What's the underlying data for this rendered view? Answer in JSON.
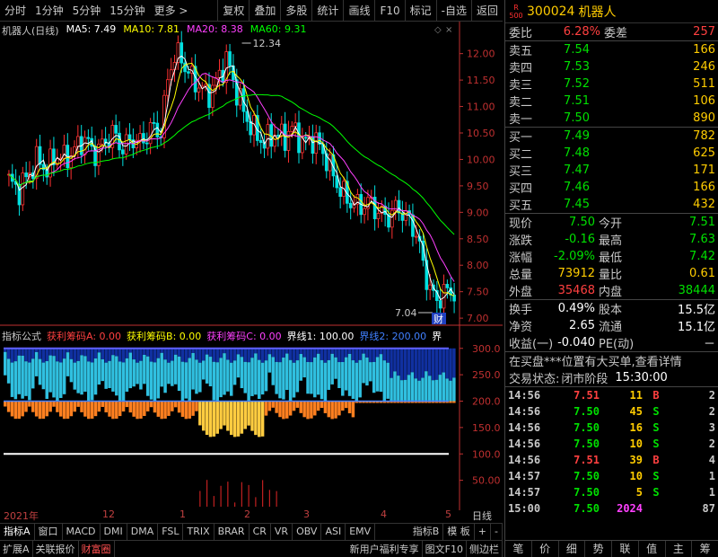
{
  "toolbar": {
    "left": [
      "分时",
      "1分钟",
      "5分钟",
      "15分钟",
      "更多 >"
    ],
    "right": [
      "复权",
      "叠加",
      "多股",
      "统计",
      "画线",
      "F10",
      "标记",
      "-自选",
      "返回"
    ]
  },
  "main_header": {
    "title": "机器人(日线)",
    "ma5": "MA5: 7.49",
    "ma10": "MA10: 7.81",
    "ma20": "MA20: 8.38",
    "ma60": "MA60: 9.31"
  },
  "indicator_header": {
    "name": "指标公式",
    "a": "获利筹码A: 0.00",
    "b": "获利筹码B: 0.00",
    "c": "获利筹码C: 0.00",
    "j1": "界线1: 100.00",
    "j2": "界线2: 200.00",
    "more": "界"
  },
  "annotations": {
    "high": "12.34",
    "low": "7.04",
    "cai": "财"
  },
  "price_axis": [
    "12.00",
    "11.50",
    "11.00",
    "10.50",
    "10.00",
    "9.50",
    "9.00",
    "8.50",
    "8.00",
    "7.50",
    "7.00"
  ],
  "ind_axis": [
    "300.0",
    "250.0",
    "200.0",
    "150.0",
    "100.0",
    "50.00"
  ],
  "x_axis": {
    "start": "2021年",
    "m12": "12",
    "m1": "1",
    "m2": "2",
    "m3": "3",
    "m4": "4",
    "m5": "5",
    "rlabel": "日线"
  },
  "bottom_tabs": [
    "指标A",
    "窗口",
    "MACD",
    "DMI",
    "DMA",
    "FSL",
    "TRIX",
    "BRAR",
    "CR",
    "VR",
    "OBV",
    "ASI",
    "EMV",
    "指标B",
    "模 板",
    "+",
    "-"
  ],
  "footer_tabs": [
    "扩展A",
    "关联报价",
    "财富圈"
  ],
  "footer_right": [
    "新用户福利专享",
    "图文F10",
    "侧边栏"
  ],
  "stock": {
    "badge_top": "R",
    "badge_bottom": "500",
    "code": "300024",
    "name": "机器人"
  },
  "order_book": {
    "ratio_label": "委比",
    "ratio": "6.28%",
    "diff_label": "委差",
    "diff": "257",
    "asks": [
      {
        "label": "卖五",
        "price": "7.54",
        "vol": "166"
      },
      {
        "label": "卖四",
        "price": "7.53",
        "vol": "246"
      },
      {
        "label": "卖三",
        "price": "7.52",
        "vol": "511"
      },
      {
        "label": "卖二",
        "price": "7.51",
        "vol": "106"
      },
      {
        "label": "卖一",
        "price": "7.50",
        "vol": "890"
      }
    ],
    "bids": [
      {
        "label": "买一",
        "price": "7.49",
        "vol": "782"
      },
      {
        "label": "买二",
        "price": "7.48",
        "vol": "625"
      },
      {
        "label": "买三",
        "price": "7.47",
        "vol": "171"
      },
      {
        "label": "买四",
        "price": "7.46",
        "vol": "166"
      },
      {
        "label": "买五",
        "price": "7.45",
        "vol": "432"
      }
    ]
  },
  "quote": [
    {
      "l1": "现价",
      "v1": "7.50",
      "c1": "#00e000",
      "l2": "今开",
      "v2": "7.51",
      "c2": "#00e000"
    },
    {
      "l1": "涨跌",
      "v1": "-0.16",
      "c1": "#00e000",
      "l2": "最高",
      "v2": "7.63",
      "c2": "#00e000"
    },
    {
      "l1": "涨幅",
      "v1": "-2.09%",
      "c1": "#00e000",
      "l2": "最低",
      "v2": "7.42",
      "c2": "#00e000"
    },
    {
      "l1": "总量",
      "v1": "73912",
      "c1": "#ffcc00",
      "l2": "量比",
      "v2": "0.61",
      "c2": "#ffcc00"
    },
    {
      "l1": "外盘",
      "v1": "35468",
      "c1": "#ff4040",
      "l2": "内盘",
      "v2": "38444",
      "c2": "#00e000"
    }
  ],
  "quote2": [
    {
      "l1": "换手",
      "v1": "0.49%",
      "l2": "股本",
      "v2": "15.5亿"
    },
    {
      "l1": "净资",
      "v1": "2.65",
      "l2": "流通",
      "v2": "15.1亿"
    },
    {
      "l1": "收益(一)",
      "v1": "-0.040",
      "l2": "PE(动)",
      "v2": "－"
    }
  ],
  "notice": "在买盘***位置有大买单,查看详情",
  "status": {
    "label": "交易状态:",
    "value": "闭市阶段",
    "time": "15:30:00"
  },
  "ticks": [
    {
      "t": "14:56",
      "p": "7.51",
      "v": "11",
      "bs": "B",
      "n": "2"
    },
    {
      "t": "14:56",
      "p": "7.50",
      "v": "45",
      "bs": "S",
      "n": "2"
    },
    {
      "t": "14:56",
      "p": "7.50",
      "v": "16",
      "bs": "S",
      "n": "3"
    },
    {
      "t": "14:56",
      "p": "7.50",
      "v": "10",
      "bs": "S",
      "n": "2"
    },
    {
      "t": "14:56",
      "p": "7.51",
      "v": "39",
      "bs": "B",
      "n": "4"
    },
    {
      "t": "14:57",
      "p": "7.50",
      "v": "10",
      "bs": "S",
      "n": "1"
    },
    {
      "t": "14:57",
      "p": "7.50",
      "v": "5",
      "bs": "S",
      "n": "1"
    },
    {
      "t": "15:00",
      "p": "7.50",
      "v": "2024",
      "bs": "",
      "n": "87"
    }
  ],
  "right_tabs": [
    "笔",
    "价",
    "细",
    "势",
    "联",
    "值",
    "主",
    "筹"
  ],
  "colors": {
    "up": "#ff3030",
    "down": "#00e0e0",
    "ma5": "#ffffff",
    "ma10": "#ffff00",
    "ma20": "#ff40ff",
    "ma60": "#00ff00"
  },
  "chart_data": {
    "type": "line",
    "title": "机器人(日线)",
    "ylim": [
      6.9,
      12.3
    ],
    "close_series_approx": [
      9.6,
      9.4,
      9.7,
      10.0,
      9.8,
      10.1,
      10.0,
      10.2,
      10.4,
      10.1,
      10.3,
      10.5,
      10.2,
      10.4,
      10.3,
      10.6,
      10.5,
      11.8,
      12.0,
      11.6,
      11.4,
      11.2,
      11.5,
      11.9,
      11.3,
      10.8,
      10.5,
      10.3,
      10.5,
      10.4,
      10.6,
      10.3,
      10.4,
      10.2,
      9.8,
      9.4,
      9.2,
      9.1,
      9.2,
      9.0,
      8.9,
      9.1,
      8.9,
      8.6,
      7.8,
      7.3,
      7.5,
      7.5
    ],
    "series": [
      {
        "name": "MA5",
        "last": 7.49
      },
      {
        "name": "MA10",
        "last": 7.81
      },
      {
        "name": "MA20",
        "last": 8.38
      },
      {
        "name": "MA60",
        "last": 9.31
      }
    ],
    "annotations": {
      "high": 12.34,
      "low": 7.04
    }
  }
}
